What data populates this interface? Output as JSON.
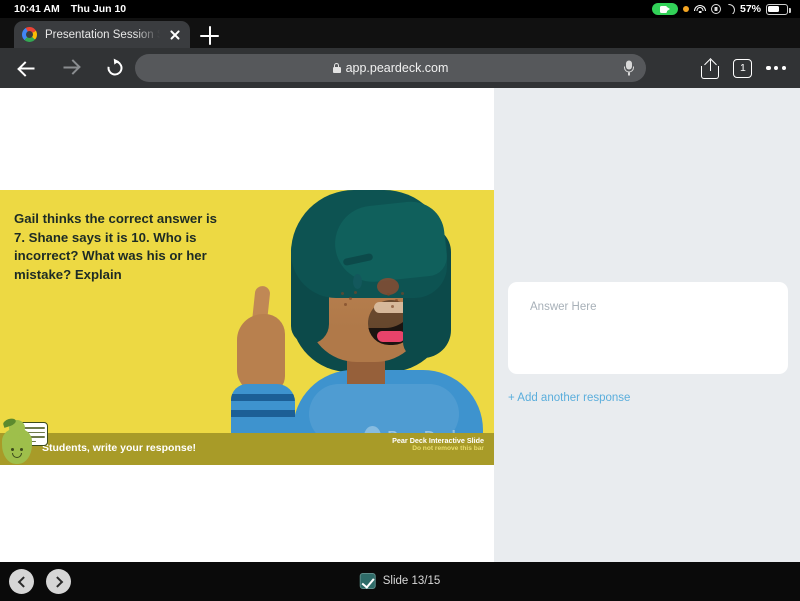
{
  "status_bar": {
    "time": "10:41 AM",
    "date": "Thu Jun 10",
    "battery_percent": "57%",
    "icons": [
      "screen-recording-pill",
      "orange-privacy-dot",
      "wifi-icon",
      "do-not-disturb-icon",
      "moon-icon",
      "battery-icon"
    ]
  },
  "browser": {
    "tab": {
      "title": "Presentation Session Stu",
      "favicon": "google-favicon",
      "close": "close-icon"
    },
    "new_tab": "+",
    "nav": {
      "back": "back-arrow-icon",
      "forward": "forward-arrow-icon",
      "reload": "reload-icon"
    },
    "omnibox": {
      "url": "app.peardeck.com",
      "lock": "lock-icon",
      "mic": "microphone-icon"
    },
    "actions": {
      "share": "share-icon",
      "tab_count": "1",
      "more": "more-options-icon"
    }
  },
  "slide": {
    "question": "Gail thinks the correct answer is 7. Shane says it is 10. Who is incorrect? What was his or her mistake? Explain",
    "bar_prompt": "Students, write your response!",
    "bar_brand_line1": "Pear Deck Interactive Slide",
    "bar_brand_line2": "Do not remove this bar",
    "watermark": "Pear Deck",
    "background_color": "#EDD943",
    "bar_color": "#A89B28",
    "mascot": "pear-mascot-icon"
  },
  "response_panel": {
    "placeholder": "Answer Here",
    "value": "",
    "add_another": "+ Add another response",
    "link_color": "#5BAEDC"
  },
  "footer": {
    "prev": "previous-slide-icon",
    "next": "next-slide-icon",
    "checkbox": "checked",
    "slide_counter": "Slide 13/15",
    "accent_color": "#2E6B68"
  }
}
